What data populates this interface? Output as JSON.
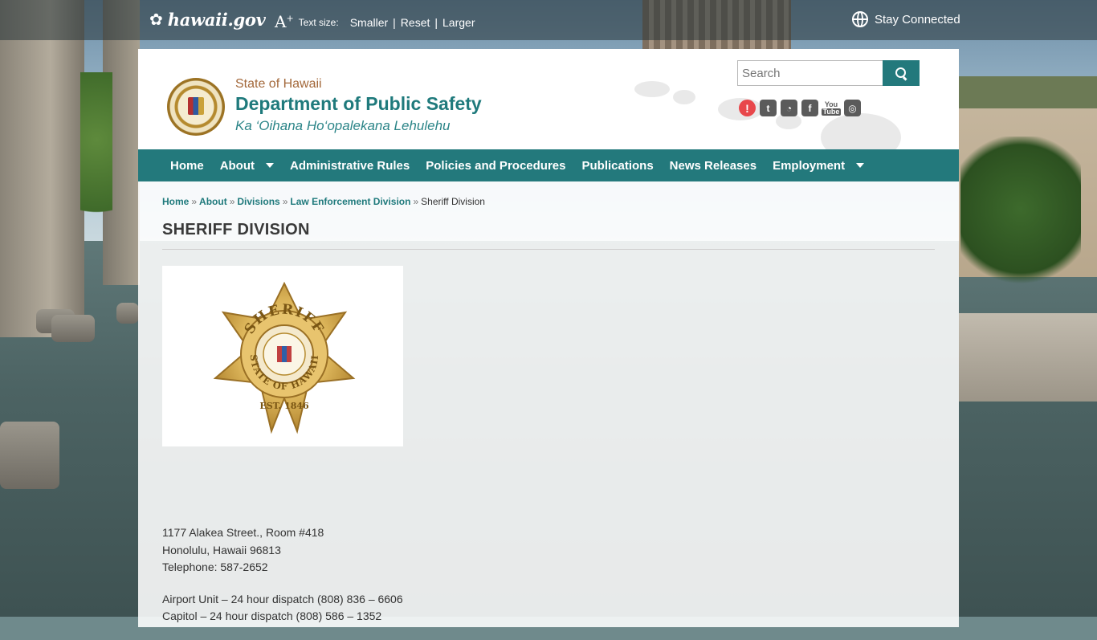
{
  "topbar": {
    "portal_name": "hawaii.gov",
    "text_size_label": "Text size:",
    "text_size_options": [
      "Smaller",
      "Reset",
      "Larger"
    ],
    "stay_connected": "Stay Connected"
  },
  "header": {
    "state": "State of Hawaii",
    "department": "Department of Public Safety",
    "hawaiian_name": "Ka ‘Oihana Ho‘opalekana Lehulehu"
  },
  "search": {
    "placeholder": "Search"
  },
  "social_icons": [
    "alert-icon",
    "twitter-icon",
    "rss-icon",
    "facebook-icon",
    "youtube-icon",
    "instagram-icon"
  ],
  "nav": {
    "items": [
      {
        "label": "Home",
        "dropdown": false
      },
      {
        "label": "About",
        "dropdown": true
      },
      {
        "label": "Administrative Rules",
        "dropdown": false
      },
      {
        "label": "Policies and Procedures",
        "dropdown": false
      },
      {
        "label": "Publications",
        "dropdown": false
      },
      {
        "label": "News Releases",
        "dropdown": false
      },
      {
        "label": "Employment",
        "dropdown": true
      }
    ]
  },
  "breadcrumb": {
    "links": [
      "Home",
      "About",
      "Divisions",
      "Law Enforcement Division"
    ],
    "current": "Sheriff Division"
  },
  "page": {
    "title": "SHERIFF DIVISION",
    "badge": {
      "top_text": "SHERIFF",
      "ring_text": "STATE OF HAWAII",
      "est_text": "EST. 1846"
    },
    "address_lines": [
      "1177 Alakea Street., Room #418",
      "Honolulu, Hawaii  96813",
      "Telephone:  587-2652"
    ],
    "dispatch_lines": [
      "Airport Unit – 24 hour dispatch (808) 836 – 6606",
      "Capitol – 24 hour dispatch (808) 586 – 1352"
    ]
  },
  "colors": {
    "brand_teal": "#23797c",
    "title_teal": "#1f7a7c",
    "state_brown": "#a3683a",
    "alert_red": "#e8474b"
  }
}
